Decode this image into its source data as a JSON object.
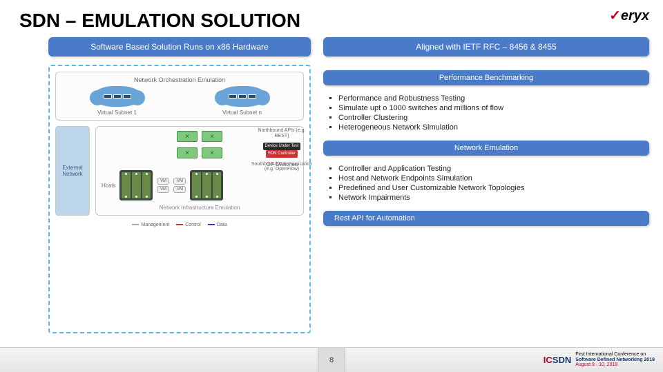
{
  "title": "SDN – EMULATION SOLUTION",
  "logo": "eryx",
  "left": {
    "header": "Software Based Solution Runs on x86 Hardware",
    "orchestration_title": "Network Orchestration Emulation",
    "subnet1_label": "Virtual Subnet 1",
    "subnet2_label": "Virtual Subnet n",
    "northbound": "Northbound APIs (e.g. REST)",
    "dut_label": "Device Under Test",
    "sdn_ctrl": "SDN Controller",
    "southbound": "Southbound Communication (e.g. OpenFlow)",
    "external_network": "External Network",
    "of_switches": "OF Switches",
    "hosts": "Hosts",
    "vm": "VM",
    "infra_label": "Network Infrastructure Emulation",
    "legend1": "Management",
    "legend2": "Control",
    "legend3": "Data"
  },
  "right": {
    "header": "Aligned with IETF  RFC – 8456 & 8455",
    "perf_title": "Performance  Benchmarking",
    "perf_items": [
      "Performance and Robustness Testing",
      "Simulate upt o 1000 switches and millions of flow",
      "Controller Clustering",
      "Heterogeneous Network Simulation"
    ],
    "emul_title": "Network Emulation",
    "emul_items": [
      "Controller and Application Testing",
      "Host and Network Endpoints Simulation",
      "Predefined and User Customizable Network Topologies",
      "Network Impairments"
    ],
    "rest_api": "Rest API for Automation"
  },
  "footer": {
    "page": "8",
    "conf_line1": "First International Conference on",
    "conf_line2": "Software Defined Networking 2019",
    "conf_line3": "August 9 - 10, 2019"
  }
}
